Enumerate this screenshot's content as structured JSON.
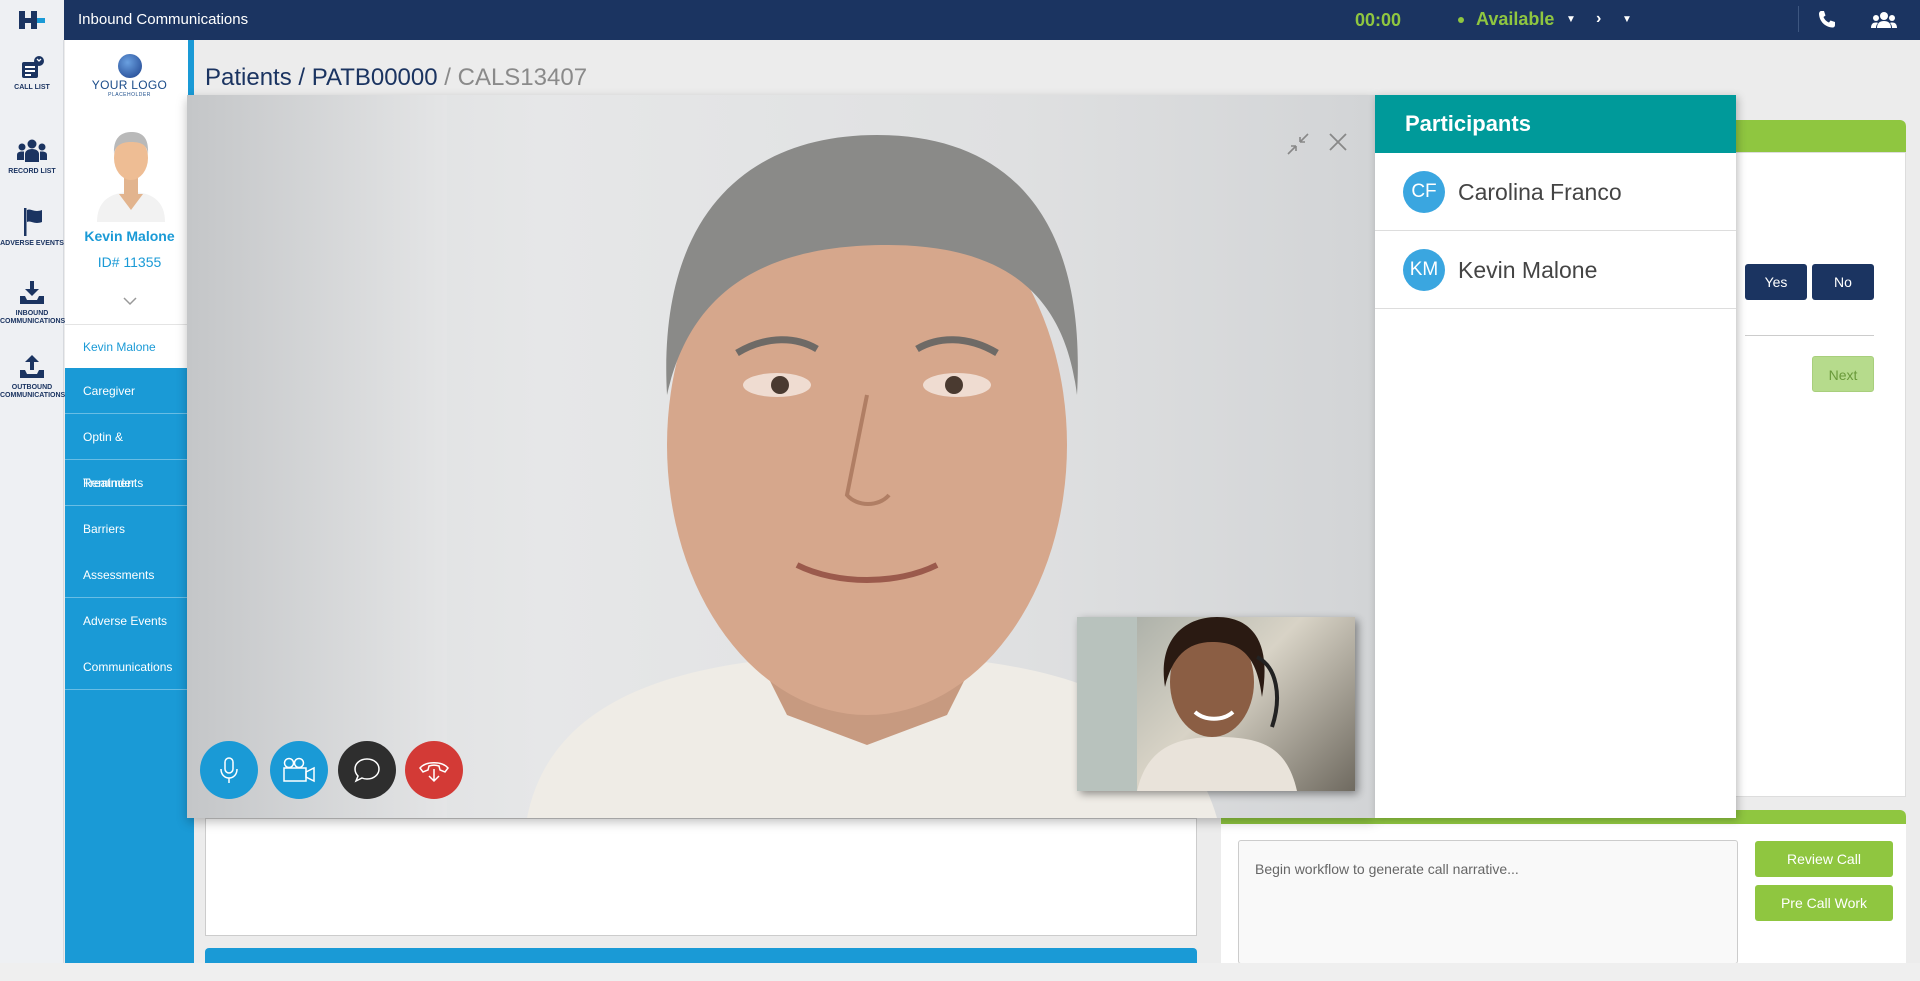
{
  "topbar": {
    "app_title": "Inbound Communications",
    "timer": "00:00",
    "status": "Available",
    "colors": {
      "bar": "#1b3461",
      "status": "#8fc640"
    },
    "icons": [
      "phone-icon",
      "team-icon"
    ]
  },
  "rail": {
    "items": [
      {
        "label": "CALL LIST",
        "icon": "call-list-icon"
      },
      {
        "label": "RECORD LIST",
        "icon": "record-list-icon"
      },
      {
        "label": "ADVERSE EVENTS",
        "icon": "flag-icon"
      },
      {
        "label_line1": "INBOUND",
        "label_line2": "COMMUNICATIONS",
        "icon": "inbound-icon"
      },
      {
        "label_line1": "OUTBOUND",
        "label_line2": "COMMUNICATIONS",
        "icon": "outbound-icon"
      }
    ]
  },
  "profile": {
    "logo_text": "YOUR LOGO",
    "logo_sub": "PLACEHOLDER",
    "name": "Kevin Malone",
    "id": "ID# 11355",
    "nav_active": "Kevin Malone",
    "nav": [
      "Caregiver",
      "Optin & Reminder",
      "Treatments",
      "Barriers",
      "Assessments",
      "Adverse Events",
      "Communications"
    ]
  },
  "breadcrumb": {
    "part1": "Patients",
    "sep1": " / ",
    "part2": "PATB00000",
    "sep2": " / ",
    "part3": "CALS13407"
  },
  "call": {
    "controls": [
      "microphone-icon",
      "video-camera-icon",
      "chat-icon",
      "hang-up-icon"
    ]
  },
  "participants": {
    "title": "Participants",
    "list": [
      {
        "initials": "CF",
        "name": "Carolina Franco"
      },
      {
        "initials": "KM",
        "name": "Kevin Malone"
      }
    ]
  },
  "workflow": {
    "yes": "Yes",
    "no": "No",
    "next": "Next",
    "narrative_placeholder": "Begin workflow to generate call narrative...",
    "review_call": "Review Call",
    "pre_call_work": "Pre Call Work"
  }
}
